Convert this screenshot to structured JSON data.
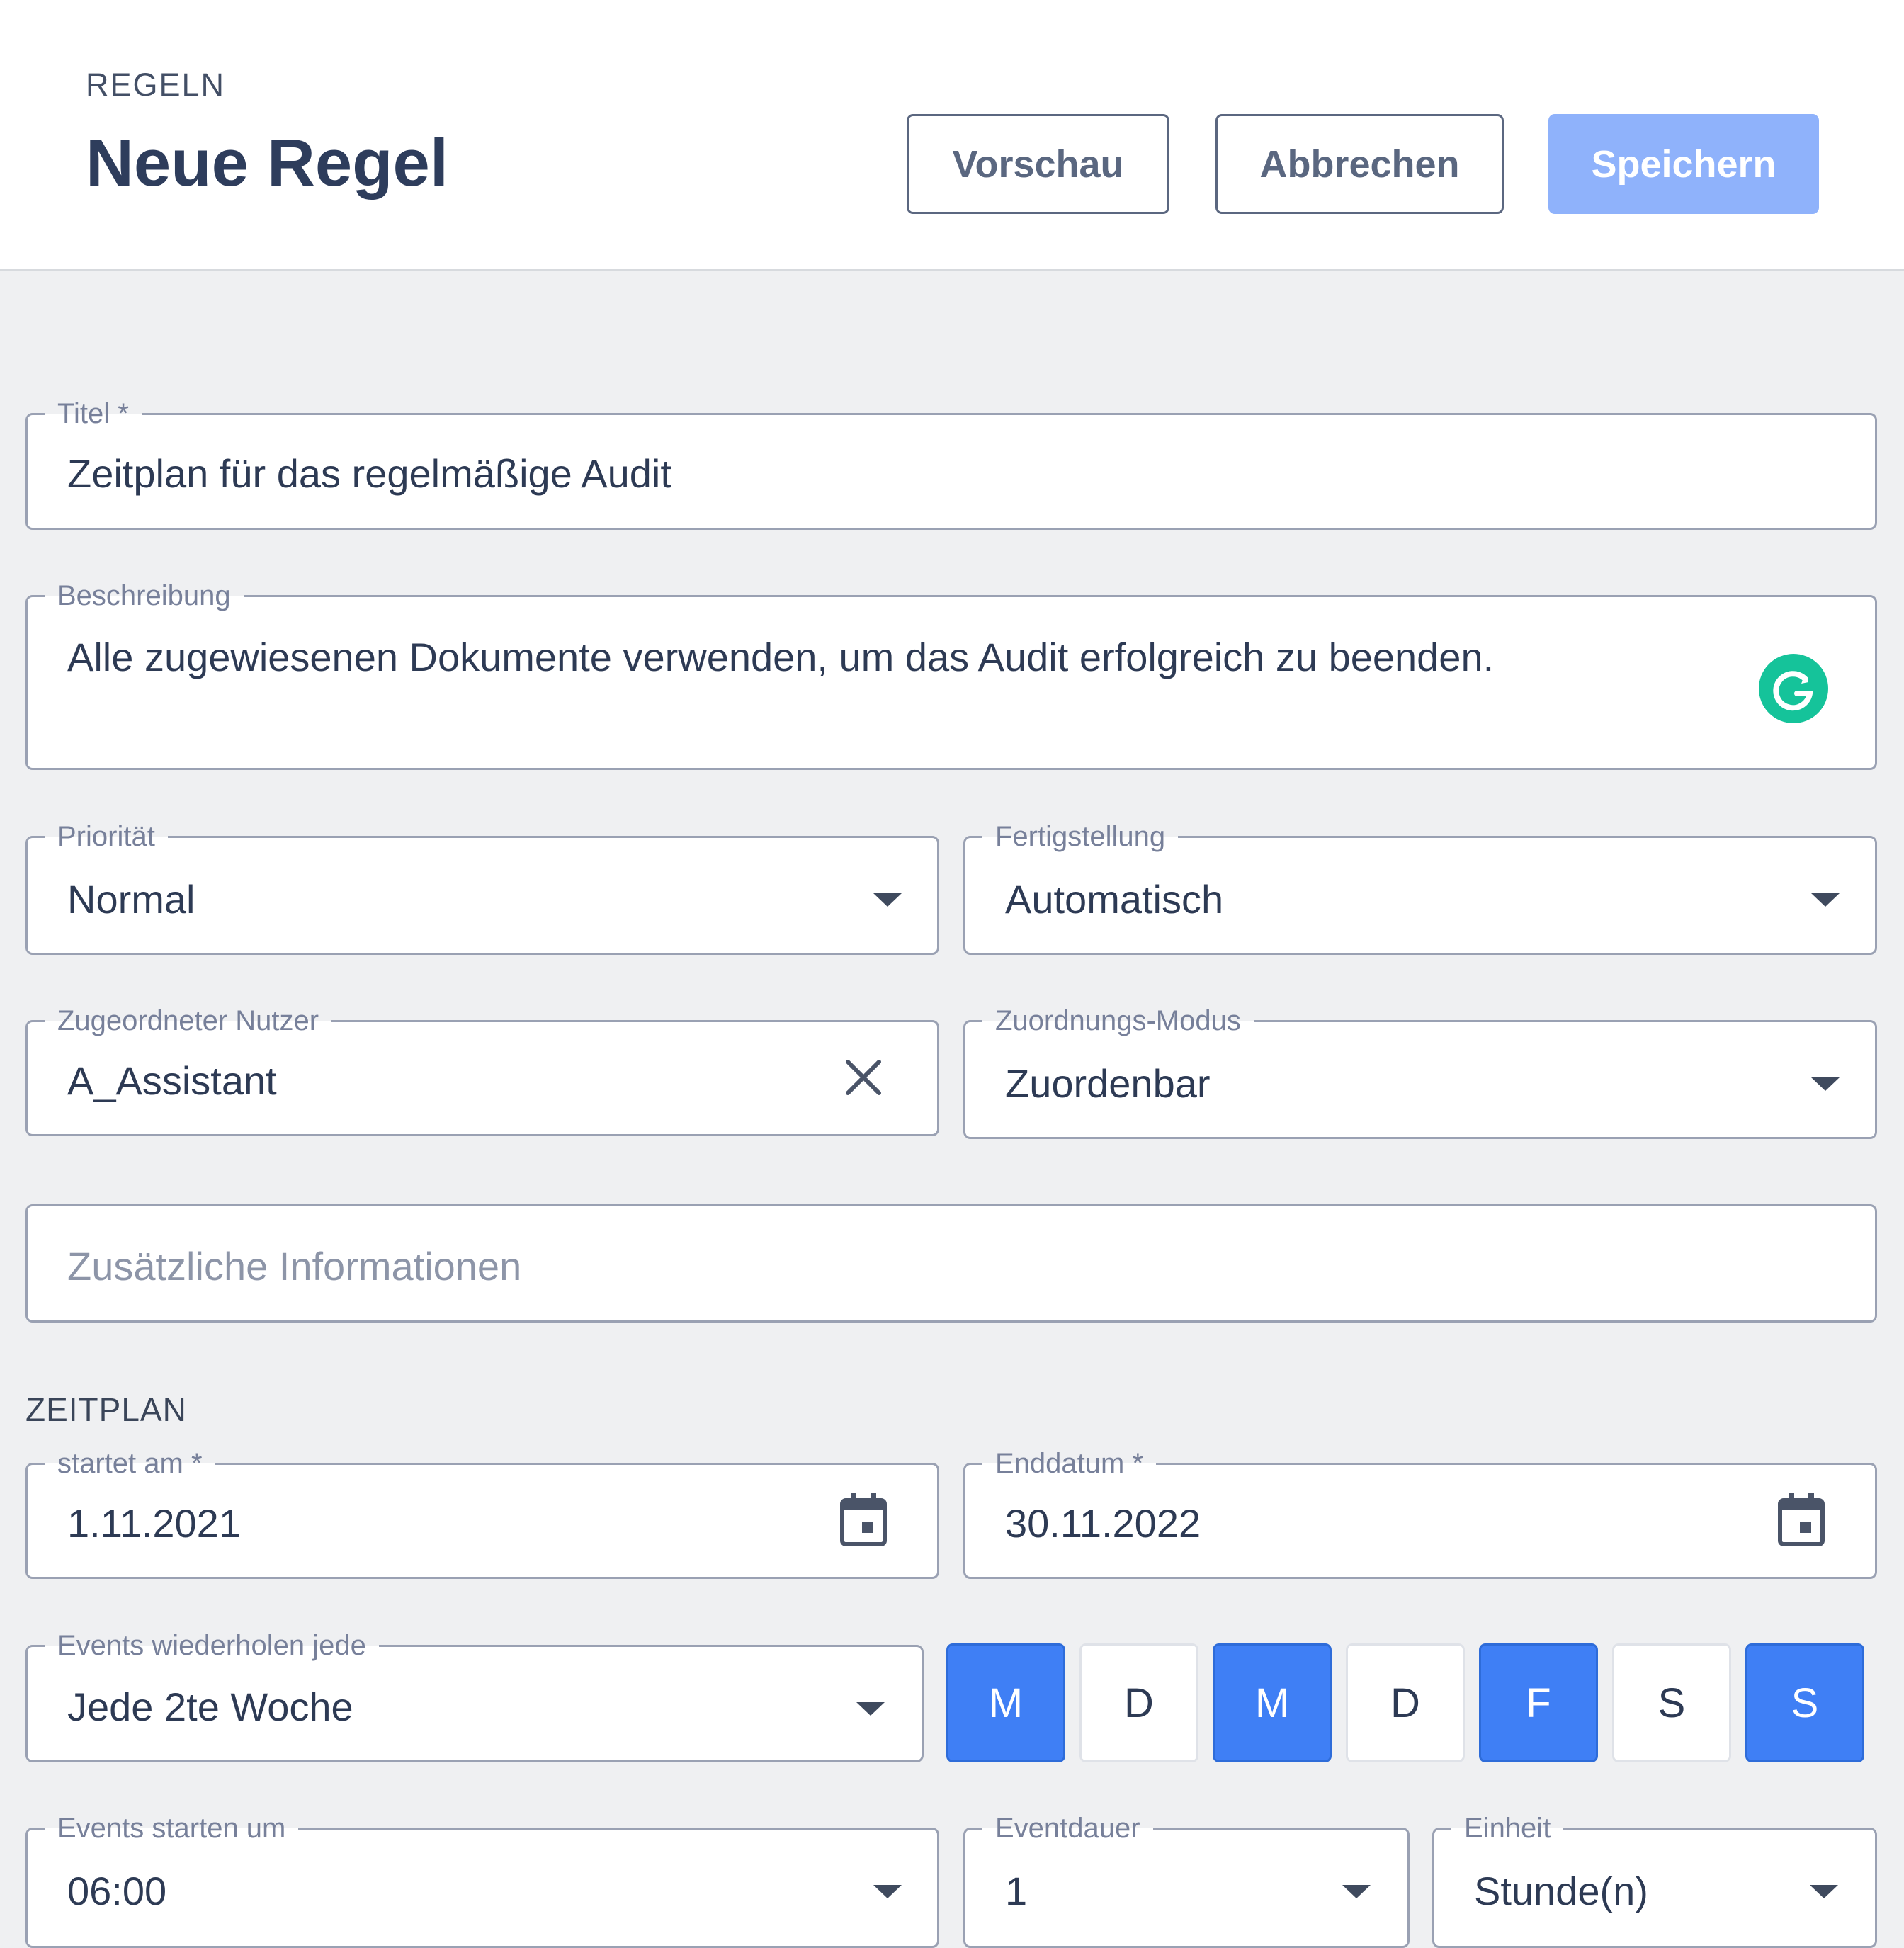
{
  "header": {
    "breadcrumb": "REGELN",
    "title": "Neue Regel",
    "buttons": {
      "preview": "Vorschau",
      "cancel": "Abbrechen",
      "save": "Speichern"
    }
  },
  "form": {
    "title": {
      "label": "Titel *",
      "value": "Zeitplan für das regelmäßige Audit"
    },
    "description": {
      "label": "Beschreibung",
      "value": "Alle zugewiesenen Dokumente verwenden, um das Audit erfolgreich zu beenden."
    },
    "priority": {
      "label": "Priorität",
      "value": "Normal"
    },
    "completion": {
      "label": "Fertigstellung",
      "value": "Automatisch"
    },
    "assigned_user": {
      "label": "Zugeordneter Nutzer",
      "value": "A_Assistant"
    },
    "assignment_mode": {
      "label": "Zuordnungs-Modus",
      "value": "Zuordenbar"
    },
    "additional_info": {
      "placeholder": "Zusätzliche Informationen"
    }
  },
  "schedule": {
    "section_label": "ZEITPLAN",
    "start_date": {
      "label": "startet am *",
      "value": "1.11.2021"
    },
    "end_date": {
      "label": "Enddatum *",
      "value": "30.11.2022"
    },
    "repeat": {
      "label": "Events wiederholen jede",
      "value": "Jede 2te Woche"
    },
    "weekdays": [
      {
        "letter": "M",
        "selected": true
      },
      {
        "letter": "D",
        "selected": false
      },
      {
        "letter": "M",
        "selected": true
      },
      {
        "letter": "D",
        "selected": false
      },
      {
        "letter": "F",
        "selected": true
      },
      {
        "letter": "S",
        "selected": false
      },
      {
        "letter": "S",
        "selected": true
      }
    ],
    "start_time": {
      "label": "Events starten um",
      "value": "06:00"
    },
    "duration": {
      "label": "Eventdauer",
      "value": "1"
    },
    "unit": {
      "label": "Einheit",
      "value": "Stunde(n)"
    }
  },
  "colors": {
    "accent": "#3f7ff5",
    "save_disabled": "#8fb2fb",
    "grammarly": "#15c39a"
  },
  "icons": [
    "dropdown-caret-icon",
    "clear-icon",
    "calendar-icon",
    "grammarly-icon"
  ]
}
